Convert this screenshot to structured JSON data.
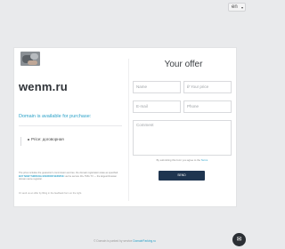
{
  "language": {
    "selected": "en",
    "caret": "▾"
  },
  "domain": "wenm.ru",
  "availability": "Domain is available for purchase:",
  "price_label": "Price: договорная",
  "note": {
    "line1": "The price includes the guarantor's commission and tax, the domain registration state as specified.",
    "link": "BUY NOW THROUGH ESCROW SERVICE",
    "line2": "via the service 30+ TMG.TV — the largest Russian domain name registrar.",
    "line3": "Or send us an offer by filling in the feedback form on the right."
  },
  "form": {
    "title": "Your offer",
    "name_placeholder": "Name",
    "price_placeholder": "₽ Your price",
    "email_placeholder": "E-mail",
    "phone_placeholder": "Phone",
    "comment_placeholder": "Comment",
    "agree_text": "By submitting this form you agree to the",
    "agree_link": "Terms",
    "send_label": "SEND"
  },
  "footer": {
    "text": "© Domain is parked by service",
    "link": "DomainParking.ru"
  },
  "chat_icon": "chat-icon"
}
